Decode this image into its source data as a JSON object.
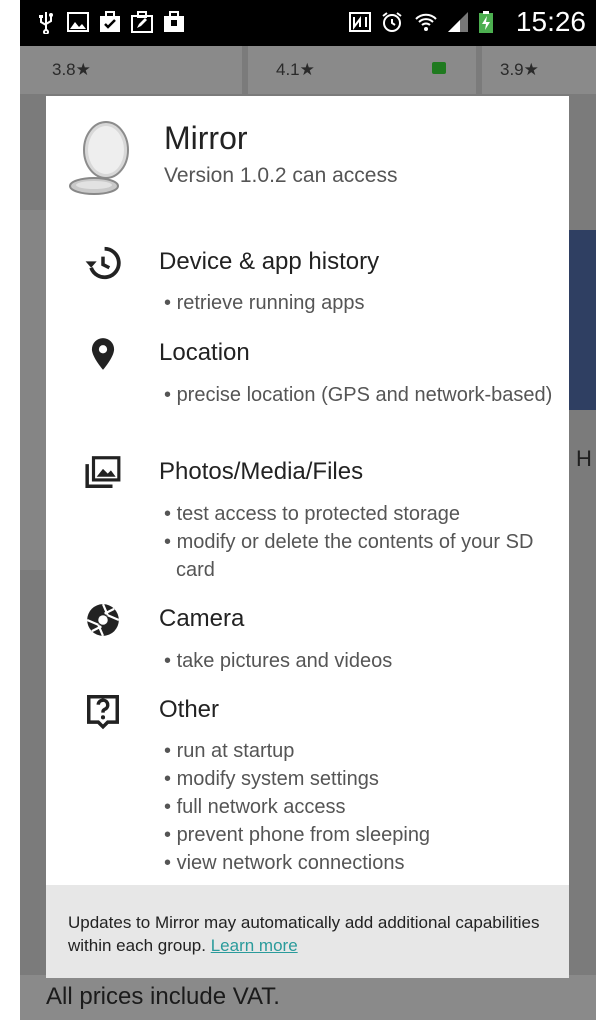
{
  "status_bar": {
    "time": "15:26",
    "icons": [
      "usb-icon",
      "image-icon",
      "bag-check-icon",
      "bag-edit-icon",
      "bag-icon",
      "nfc-icon",
      "alarm-icon",
      "wifi-icon",
      "signal-icon",
      "battery-charging-icon"
    ]
  },
  "background": {
    "ratings": [
      "3.8★",
      "4.1★",
      "3.9★"
    ],
    "side_char": "H",
    "footer_text": "All prices include VAT."
  },
  "dialog": {
    "app_name": "Mirror",
    "app_icon": "mirror-compact-icon",
    "version_text": "Version 1.0.2 can access",
    "permissions": [
      {
        "icon": "history-icon",
        "title": "Device & app history",
        "items": [
          "retrieve running apps"
        ]
      },
      {
        "icon": "location-pin-icon",
        "title": "Location",
        "items": [
          "precise location (GPS and network-based)"
        ]
      },
      {
        "icon": "photos-icon",
        "title": "Photos/Media/Files",
        "items": [
          "test access to protected storage",
          "modify or delete the contents of your SD card"
        ]
      },
      {
        "icon": "camera-aperture-icon",
        "title": "Camera",
        "items": [
          "take pictures and videos"
        ]
      },
      {
        "icon": "question-box-icon",
        "title": "Other",
        "items": [
          "run at startup",
          "modify system settings",
          "full network access",
          "prevent phone from sleeping",
          "view network connections"
        ]
      }
    ],
    "note": {
      "text": "Updates to Mirror may automatically add additional capabilities within each group.",
      "link": "Learn more"
    }
  },
  "colors": {
    "dim_background": "#7b7b7b",
    "dialog": "#ffffff",
    "note_background": "#e7e7e7",
    "link": "#2a9b9b"
  }
}
